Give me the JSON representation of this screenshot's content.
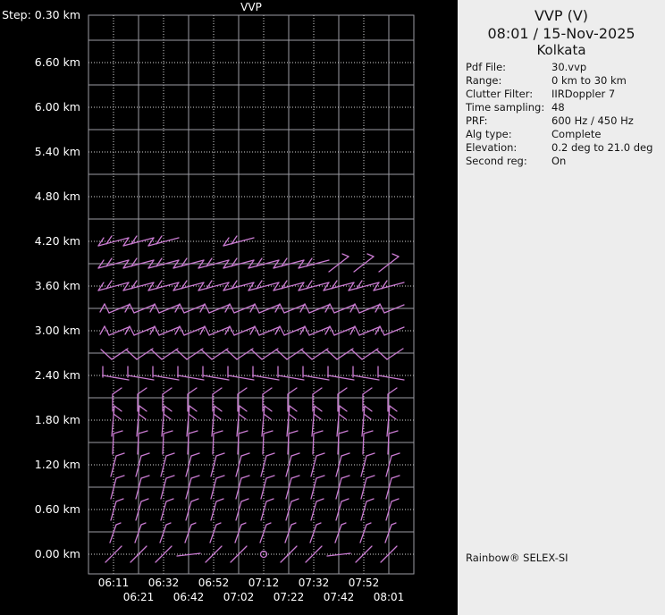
{
  "app": {
    "product": "Rainbow® SELEX-SI"
  },
  "plot": {
    "title": "VVP",
    "step_label": "Step: 0.30 km",
    "y_axis": {
      "labels": [
        "6.60 km",
        "6.00 km",
        "5.40 km",
        "4.80 km",
        "4.20 km",
        "3.60 km",
        "3.00 km",
        "2.40 km",
        "1.80 km",
        "1.20 km",
        "0.60 km",
        "0.00 km"
      ],
      "step_km": 0.3
    },
    "x_axis": {
      "labels_row1": [
        "06:11",
        "06:32",
        "06:52",
        "07:12",
        "07:32",
        "07:52"
      ],
      "labels_row2": [
        "06:21",
        "06:42",
        "07:02",
        "07:22",
        "07:42",
        "08:01"
      ]
    },
    "colors": {
      "background": "#000000",
      "text": "#ffffff",
      "grid_solid": "#9c9ca3",
      "grid_dotted": "#d6d6d6",
      "barb": "#ca7bd2"
    },
    "barbs": {
      "templates": {
        "wd": [
          [
            -17,
            5,
            17,
            -4
          ],
          [
            -17,
            5,
            -11,
            -4
          ],
          [
            -8,
            3,
            -2,
            -6
          ]
        ],
        "sw": [
          [
            -11,
            9,
            11,
            -8
          ],
          [
            11,
            -8,
            4,
            -11
          ]
        ],
        "wv": [
          [
            -15,
            4,
            -10,
            -5
          ],
          [
            -10,
            -5,
            -5,
            5
          ],
          [
            -5,
            5,
            17,
            -4
          ]
        ],
        "vee": [
          [
            -14,
            -4,
            -2,
            7
          ],
          [
            -2,
            7,
            16,
            -5
          ]
        ],
        "etk": [
          [
            -12,
            -10,
            -12,
            2
          ],
          [
            -12,
            0,
            17,
            5
          ]
        ],
        "ndg": [
          [
            9,
            -11,
            -1,
            -4
          ],
          [
            -1,
            -4,
            -1,
            15
          ]
        ],
        "n2": [
          [
            1,
            -16,
            -2,
            18
          ],
          [
            1,
            -16,
            9,
            -10
          ],
          [
            0,
            -7,
            8,
            -1
          ]
        ],
        "n1": [
          [
            0,
            -10,
            -1,
            13
          ],
          [
            0,
            -10,
            10,
            -13
          ]
        ],
        "nne": [
          [
            -3,
            13,
            3,
            -10
          ],
          [
            3,
            -10,
            12,
            -13
          ]
        ],
        "nne_s": [
          [
            -3,
            12,
            3,
            -9
          ],
          [
            3,
            -9,
            11,
            -12
          ]
        ],
        "nne_h": [
          [
            -4,
            12,
            3,
            -8
          ],
          [
            3,
            -8,
            8,
            -10
          ]
        ],
        "slash": [
          [
            -9,
            9,
            9,
            -9
          ]
        ],
        "flat": [
          [
            -13,
            2,
            13,
            -1
          ]
        ]
      },
      "rows": [
        {
          "height_km": 4.2,
          "template": "wd",
          "cols": [
            1,
            2,
            3,
            6
          ]
        },
        {
          "height_km": 3.9,
          "template": "wd",
          "cols": [
            1,
            2,
            3,
            4,
            5,
            6,
            7,
            8,
            9,
            10,
            11,
            12
          ],
          "overrides": {
            "10": "sw",
            "11": "sw",
            "12": "sw"
          }
        },
        {
          "height_km": 3.6,
          "template": "wd",
          "cols": [
            1,
            2,
            3,
            4,
            5,
            6,
            7,
            8,
            9,
            10,
            11,
            12
          ]
        },
        {
          "height_km": 3.3,
          "template": "wv",
          "cols": [
            1,
            2,
            3,
            4,
            5,
            6,
            7,
            8,
            9,
            10,
            11,
            12
          ]
        },
        {
          "height_km": 3.0,
          "template": "wv",
          "cols": [
            1,
            2,
            3,
            4,
            5,
            6,
            7,
            8,
            9,
            10,
            11,
            12
          ]
        },
        {
          "height_km": 2.7,
          "template": "vee",
          "cols": [
            1,
            2,
            3,
            4,
            5,
            6,
            7,
            8,
            9,
            10,
            11,
            12
          ]
        },
        {
          "height_km": 2.4,
          "template": "etk",
          "cols": [
            1,
            2,
            3,
            4,
            5,
            6,
            7,
            8,
            9,
            10,
            11,
            12
          ]
        },
        {
          "height_km": 2.1,
          "template": "ndg",
          "cols": [
            1,
            2,
            3,
            4,
            5,
            6,
            7,
            8,
            9,
            10,
            11,
            12
          ]
        },
        {
          "height_km": 1.8,
          "template": "n2",
          "cols": [
            1,
            2,
            3,
            4,
            5,
            6,
            7,
            8,
            9,
            10,
            11,
            12
          ]
        },
        {
          "height_km": 1.5,
          "template": "n1",
          "cols": [
            1,
            2,
            3,
            4,
            5,
            6,
            7,
            8,
            9,
            10,
            11,
            12
          ]
        },
        {
          "height_km": 1.2,
          "template": "nne",
          "cols": [
            1,
            2,
            3,
            4,
            5,
            6,
            7,
            8,
            9,
            10,
            11,
            12
          ]
        },
        {
          "height_km": 0.9,
          "template": "nne",
          "cols": [
            1,
            2,
            3,
            4,
            5,
            6,
            7,
            8,
            9,
            10,
            11,
            12
          ]
        },
        {
          "height_km": 0.6,
          "template": "nne_s",
          "cols": [
            1,
            2,
            3,
            4,
            5,
            6,
            7,
            8,
            9,
            10,
            11,
            12
          ]
        },
        {
          "height_km": 0.3,
          "template": "nne_h",
          "cols": [
            1,
            2,
            3,
            4,
            5,
            6,
            7,
            8,
            9,
            10,
            11,
            12
          ]
        },
        {
          "height_km": 0.0,
          "template": "slash",
          "cols": [
            1,
            2,
            3,
            4,
            5,
            6,
            8,
            9,
            10,
            11,
            12
          ],
          "overrides": {
            "4": "flat",
            "10": "flat"
          }
        }
      ],
      "calm_marker": {
        "height_km": 0.0,
        "col": 7
      }
    }
  },
  "panel": {
    "title": "VVP (V)",
    "datetime": "08:01 / 15-Nov-2025",
    "site": "Kolkata",
    "fields": [
      {
        "label": "Pdf File:",
        "value": "30.vvp"
      },
      {
        "label": "Range:",
        "value": "0 km to 30 km"
      },
      {
        "label": "Clutter Filter:",
        "value": "IIRDoppler 7"
      },
      {
        "label": "Time sampling:",
        "value": "48"
      },
      {
        "label": "PRF:",
        "value": "600 Hz / 450 Hz"
      },
      {
        "label": "Alg type:",
        "value": "Complete"
      },
      {
        "label": "Elevation:",
        "value": "0.2 deg to 21.0 deg"
      },
      {
        "label": "Second reg:",
        "value": "On"
      }
    ],
    "footer": "Rainbow® SELEX-SI"
  }
}
